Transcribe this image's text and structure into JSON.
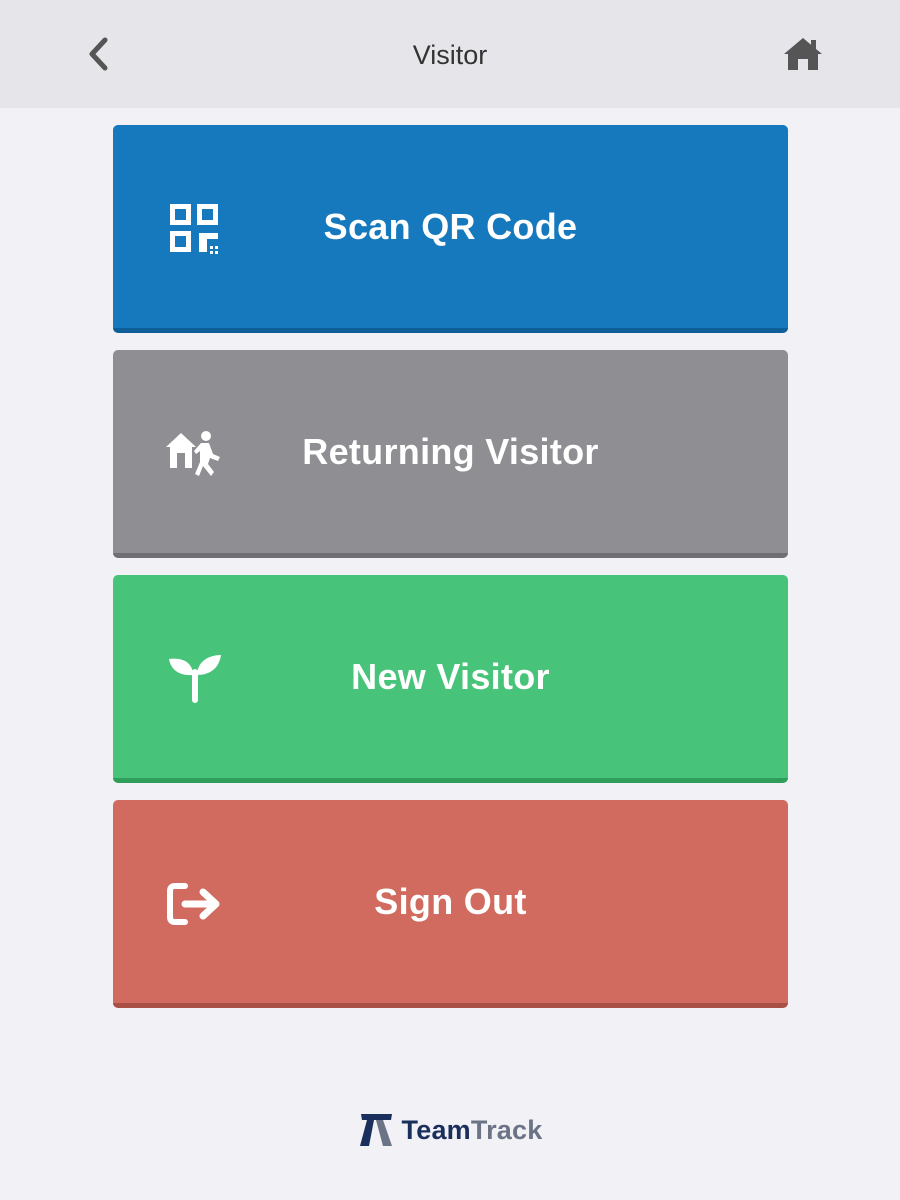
{
  "header": {
    "title": "Visitor",
    "back_icon": "chevron-left-icon",
    "home_icon": "home-icon"
  },
  "buttons": [
    {
      "label": "Scan QR Code",
      "icon": "qr-code-icon",
      "color": "#1779bd"
    },
    {
      "label": "Returning Visitor",
      "icon": "returning-visitor-icon",
      "color": "#8e8e93"
    },
    {
      "label": "New Visitor",
      "icon": "seedling-icon",
      "color": "#47c479"
    },
    {
      "label": "Sign Out",
      "icon": "sign-out-icon",
      "color": "#d16b5f"
    }
  ],
  "brand": {
    "name_part1": "Team",
    "name_part2": "Track",
    "icon": "teamtrack-logo"
  }
}
